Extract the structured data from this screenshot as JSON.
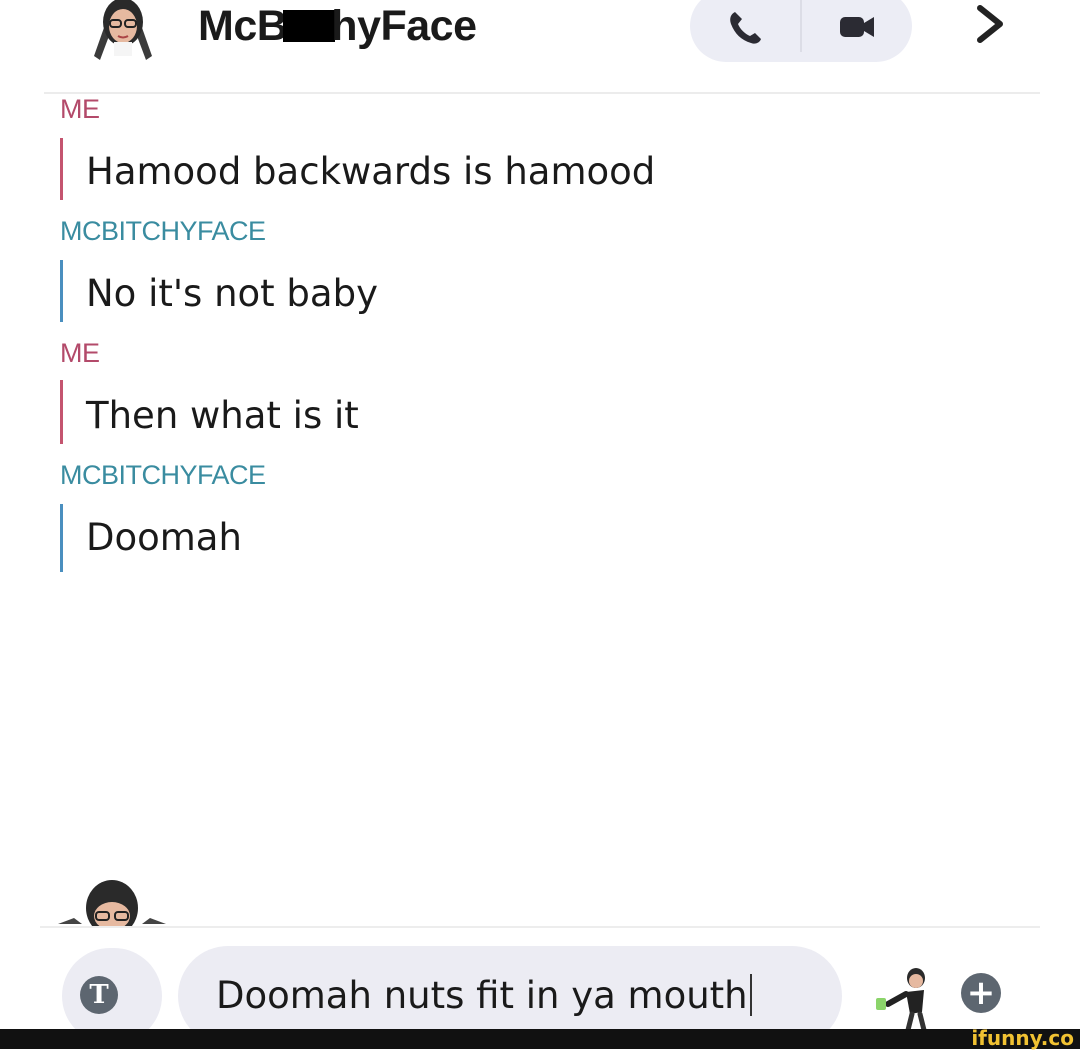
{
  "header": {
    "title_prefix": "McB",
    "title_suffix": "hyFace",
    "avatar_icon": "avatar-bitmoji-icon",
    "call_icon": "phone-icon",
    "video_icon": "video-camera-icon",
    "chevron_icon": "chevron-right-icon"
  },
  "messages": [
    {
      "sender": "ME",
      "text": "Hamood backwards is hamood",
      "from": "me"
    },
    {
      "sender": "MCBITCHYFACE",
      "text": "No it's not baby",
      "from": "them"
    },
    {
      "sender": "ME",
      "text": "Then what is it",
      "from": "me"
    },
    {
      "sender": "MCBITCHYFACE",
      "text": "Doomah",
      "from": "them"
    }
  ],
  "composer": {
    "text_icon_label": "T",
    "input_value": "Doomah nuts fit in ya mouth",
    "plus_label": "+"
  },
  "watermark": {
    "text": "ifunny.co"
  },
  "colors": {
    "me": "#c4546f",
    "them": "#4a8fbf",
    "pill_bg": "#ececf3",
    "icon_gray": "#5d6670"
  }
}
